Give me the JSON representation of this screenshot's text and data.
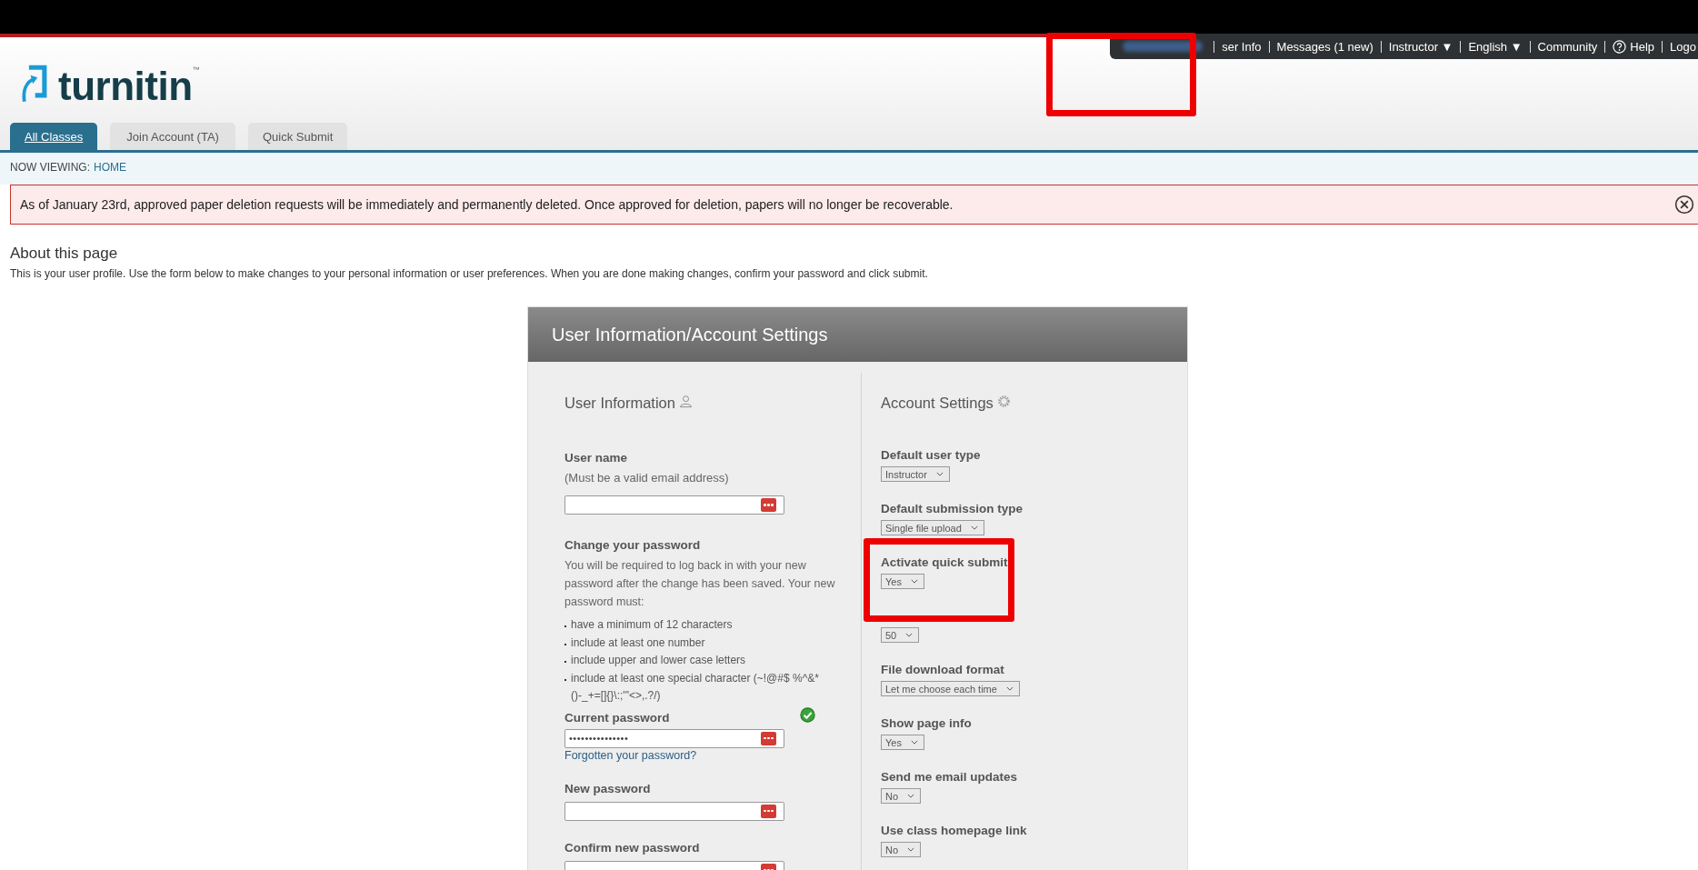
{
  "top_nav": {
    "items": [
      {
        "label": "ser Info",
        "kind": "link"
      },
      {
        "label": "Messages (1 new)",
        "kind": "link"
      },
      {
        "label": "Instructor",
        "kind": "dropdown",
        "caret": "▼"
      },
      {
        "label": "English",
        "kind": "dropdown",
        "caret": "▼"
      },
      {
        "label": "Community",
        "kind": "link"
      },
      {
        "label": "Help",
        "kind": "help"
      },
      {
        "label": "Logo",
        "kind": "link"
      }
    ]
  },
  "logo": {
    "wordmark": "turnitin",
    "trademark": "™"
  },
  "tabs": [
    {
      "label": "All Classes",
      "selected": true
    },
    {
      "label": "Join Account (TA)",
      "selected": false
    },
    {
      "label": "Quick Submit",
      "selected": false
    }
  ],
  "breadcrumb": {
    "label": "NOW VIEWING:",
    "current": "HOME"
  },
  "alert": {
    "text": "As of January 23rd, approved paper deletion requests will be immediately and permanently deleted. Once approved for deletion, papers will no longer be recoverable."
  },
  "about": {
    "heading": "About this page",
    "text": "This is your user profile. Use the form below to make changes to your personal information or user preferences. When you are done making changes, confirm your password and click submit."
  },
  "panel": {
    "title": "User Information/Account Settings",
    "user_information": {
      "heading": "User Information",
      "user_name": {
        "label": "User name",
        "note": "(Must be a valid email address)"
      },
      "change_password": {
        "heading": "Change your password",
        "text": "You will be required to log back in with your new password after the change has been saved. Your new password must:",
        "requirements": [
          "have a minimum of 12 characters",
          "include at least one number",
          "include upper and lower case letters",
          "include at least one special character (~!@#$ %^&*()-_+=[]{}\\:;'\"<>,.?/)"
        ]
      },
      "current_password": {
        "label": "Current password",
        "value": "•••••••••••••••",
        "verified": true,
        "link": "Forgotten your password?"
      },
      "new_password": {
        "label": "New password"
      },
      "confirm_password": {
        "label": "Confirm new password"
      }
    },
    "account_settings": {
      "heading": "Account Settings",
      "settings": [
        {
          "label": "Default user type",
          "value": "Instructor"
        },
        {
          "label": "Default submission type",
          "value": "Single file upload"
        },
        {
          "label": "Activate quick submit",
          "value": "Yes"
        },
        {
          "value": "50"
        },
        {
          "label": "File download format",
          "value": "Let me choose each time"
        },
        {
          "label": "Show page info",
          "value": "Yes"
        },
        {
          "label": "Send me email updates",
          "value": "No"
        },
        {
          "label": "Use class homepage link",
          "value": "No"
        }
      ]
    }
  }
}
